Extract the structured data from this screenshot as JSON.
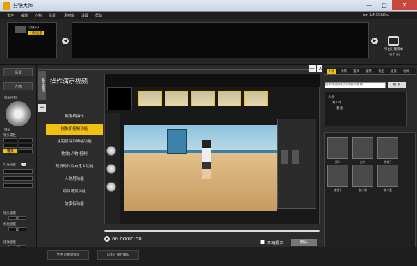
{
  "window": {
    "title": "分镜大师",
    "controls": [
      "—",
      "□",
      "✕"
    ]
  },
  "menu": [
    "文件",
    "编辑",
    "人物",
    "场景",
    "素材库",
    "设置",
    "帮助"
  ],
  "account": "om_LiNXGhDtu",
  "timeline": {
    "shot1": "○镜头1",
    "shot2": "分镜画面"
  },
  "export": {
    "label": "导出分镜脚本",
    "sub": "导出 Ks"
  },
  "left": {
    "btn1": "场景",
    "btn2": "人物",
    "btn3": "镜头控制",
    "btn4": "镜头",
    "section_camera": "镜头属性",
    "fields": [
      "机位",
      "焦距",
      "角度",
      "高度"
    ],
    "lens_label": "镜头 50mm",
    "section_light": "灯光设置",
    "labels": [
      "镜头速度",
      "机位速度",
      "播放速度"
    ],
    "values": [
      "10",
      "10",
      "1.00"
    ]
  },
  "dialog": {
    "side_tab": "新手指引",
    "title": "操作演示视频",
    "items": [
      "摄像机操作",
      "摄像机控制功能",
      "焦距景深及画幅功能",
      "物体(人物)控制",
      "预设动作及自定义功能",
      "人物层功能",
      "项目场景功能",
      "故事板功能"
    ],
    "active_index": 1,
    "time": "00:00/00:00",
    "no_more": "不再提示",
    "confirm": "确认",
    "close": "X",
    "minimize": "—"
  },
  "right": {
    "tabs": [
      "人物",
      "场景",
      "道具",
      "服装",
      "发型",
      "道具",
      "动物"
    ],
    "search_placeholder": "搜索关键字找到你要的素材",
    "search_btn": "搜 索",
    "tree": [
      "人物",
      "青少年",
      "普通"
    ],
    "chars": [
      "男人",
      "女人",
      "男性2",
      "女性2",
      "老人男",
      "老人女"
    ]
  },
  "bottom": {
    "b1": "文件 应用到镜头",
    "b2": "Enter 保存镜头"
  },
  "colors": {
    "accent": "#f2c010",
    "bg": "#2b2b2b"
  }
}
